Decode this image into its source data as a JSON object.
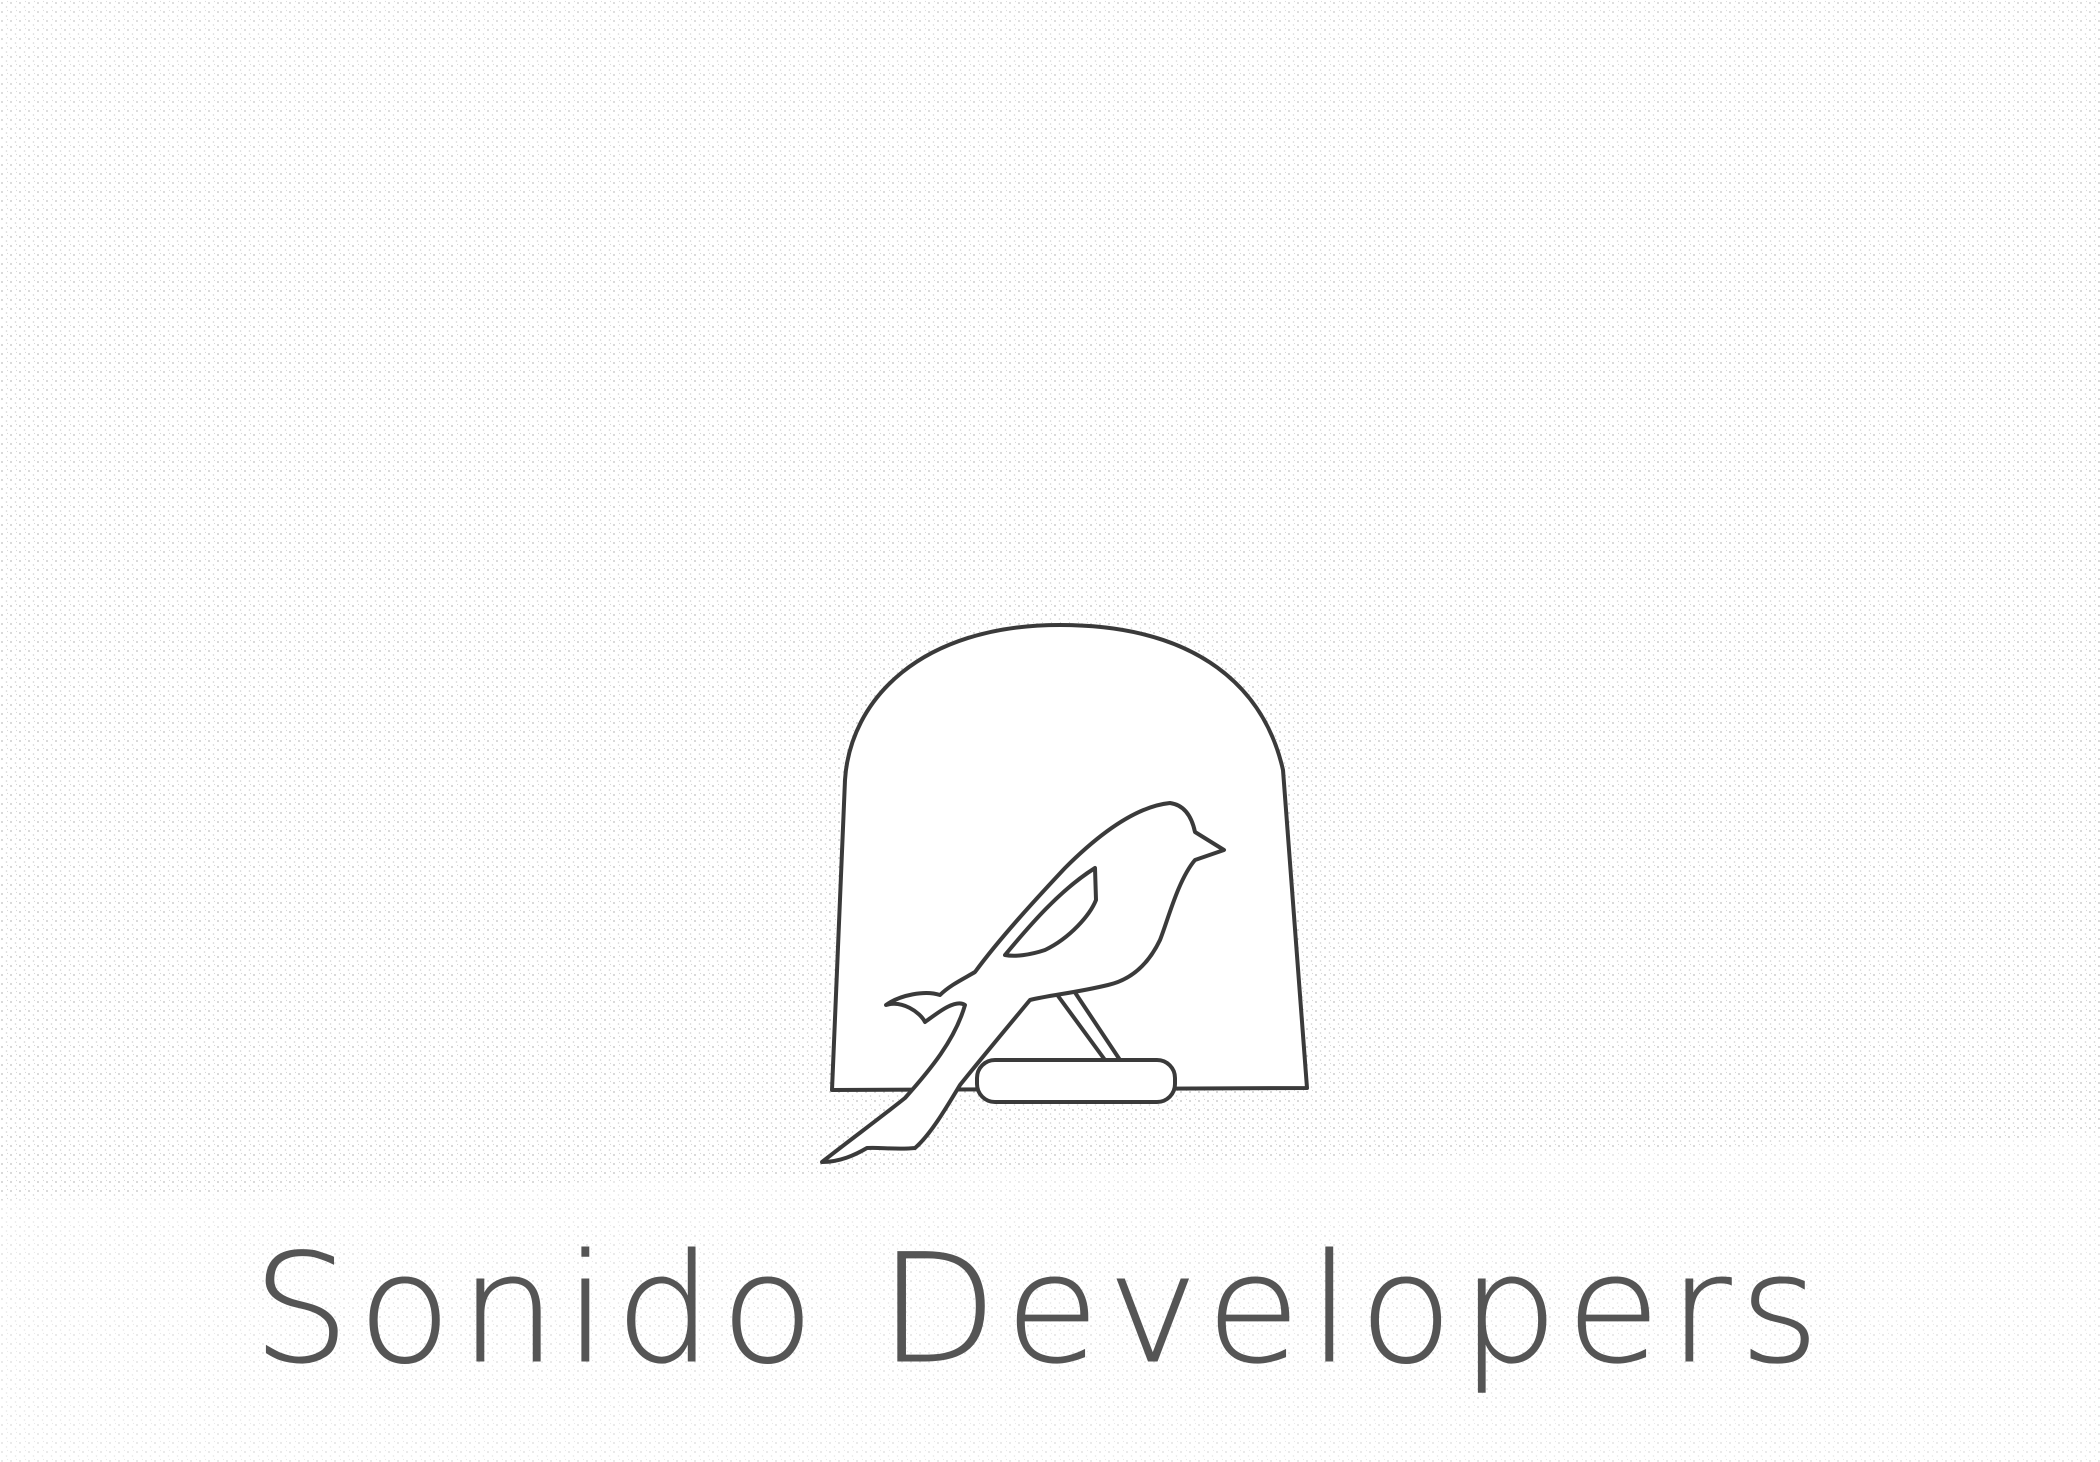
{
  "logo": {
    "wordmark": "Sonido Developers",
    "icon": "bird-on-perch-in-arch",
    "colors": {
      "ink": "#3a3a3a",
      "paper": "#ffffff",
      "stipple": "#cfcfcf"
    }
  }
}
